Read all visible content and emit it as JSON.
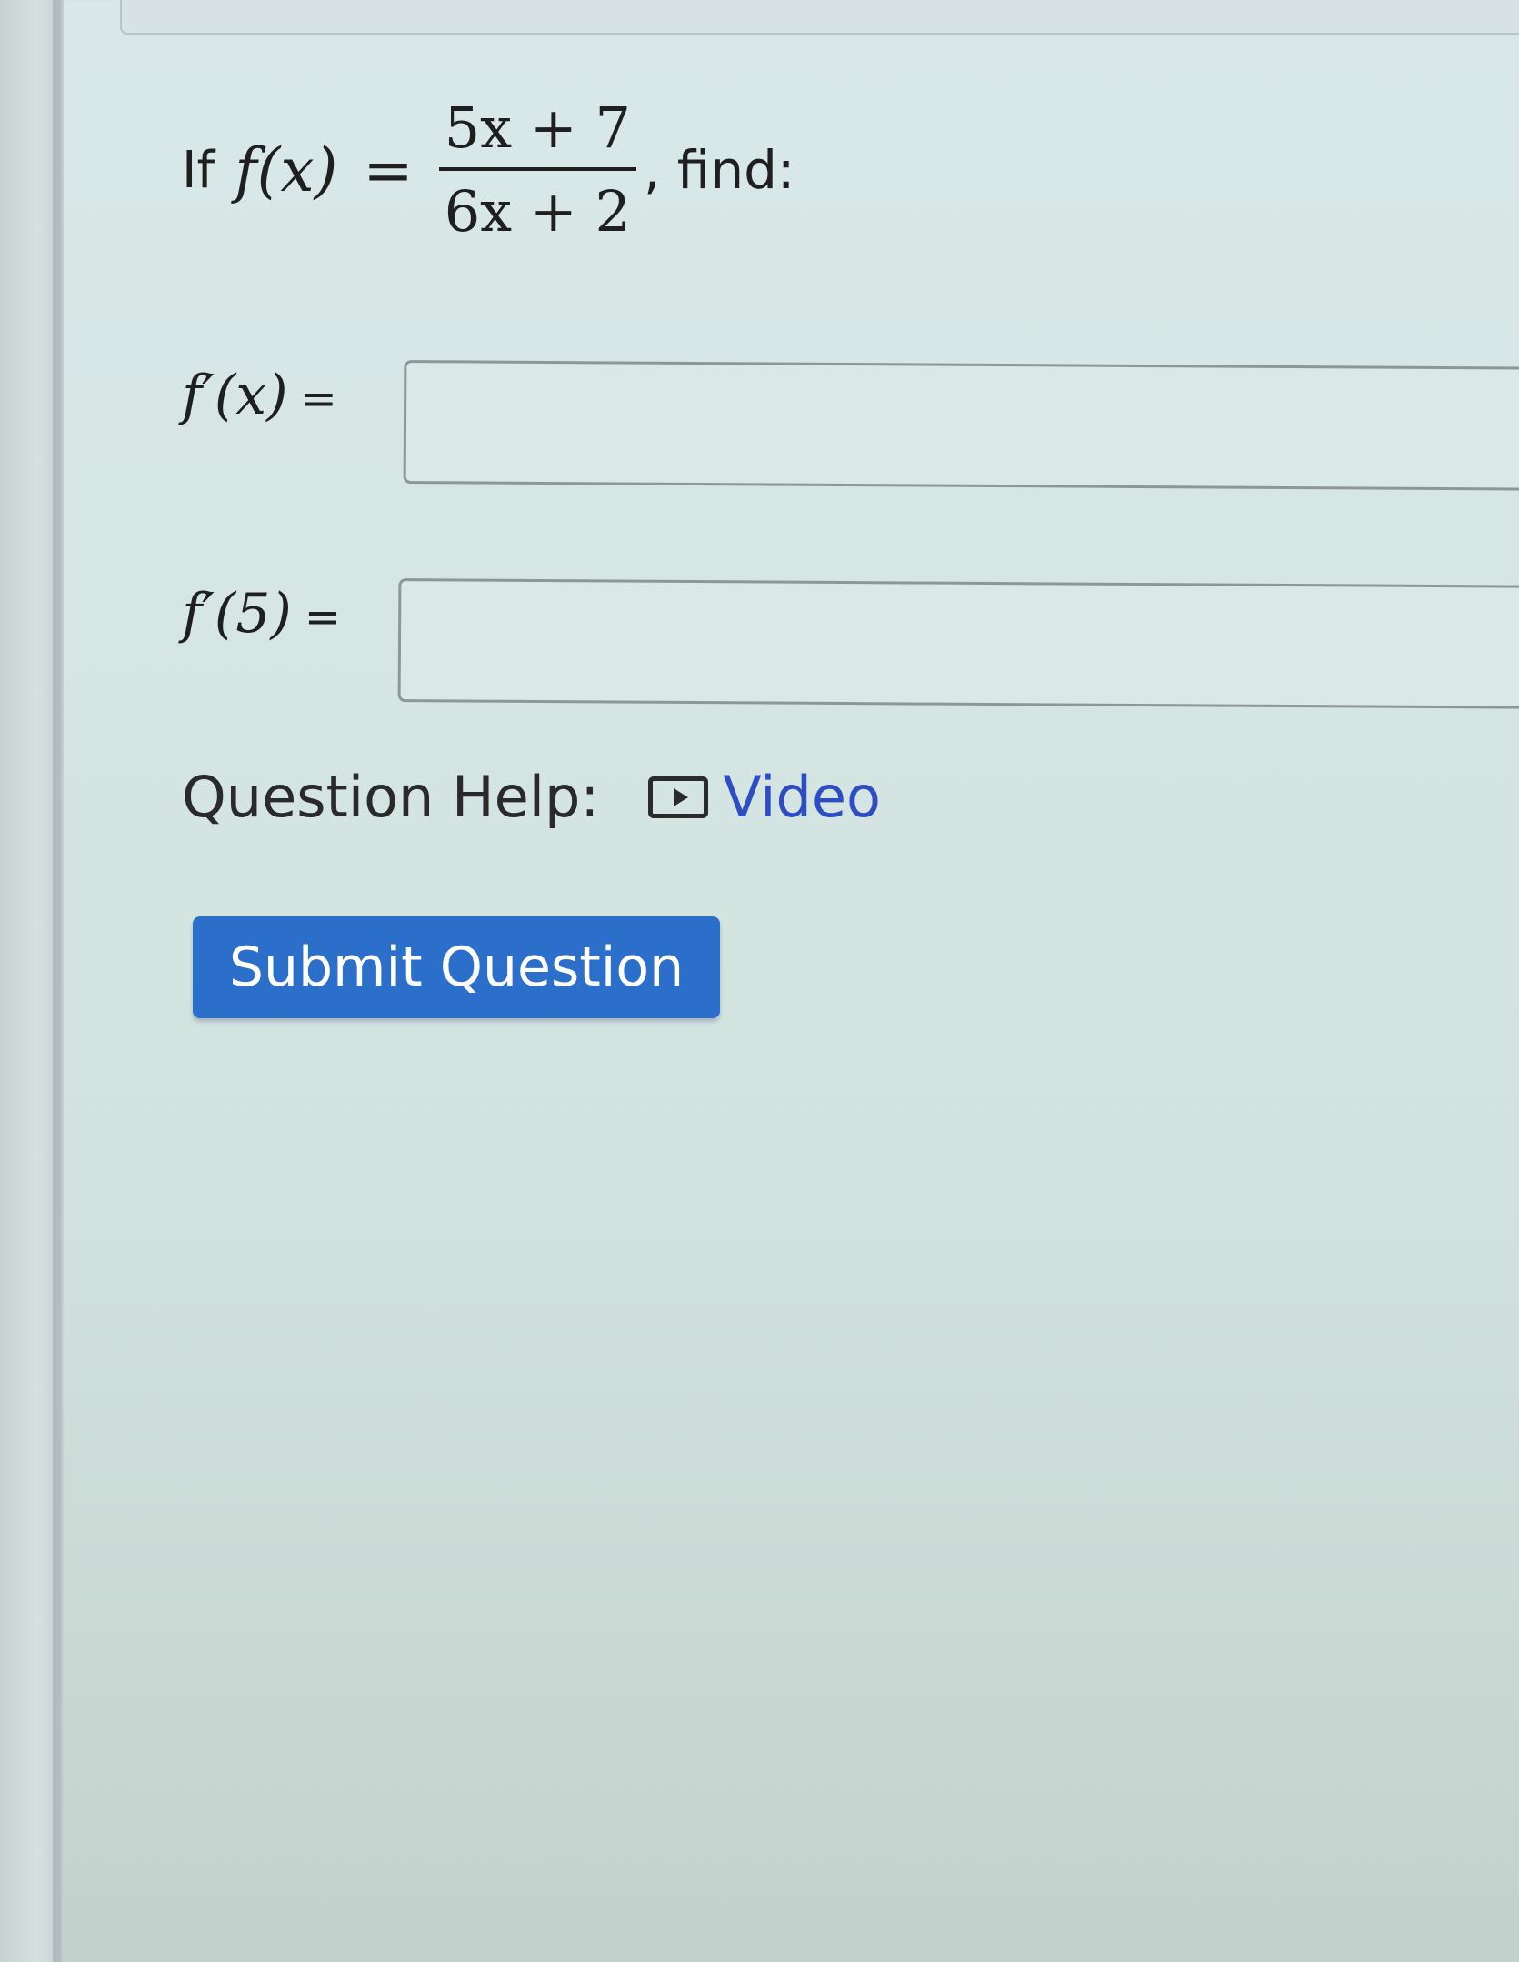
{
  "question": {
    "prefix": "If",
    "function_name": "f(x)",
    "equals": "=",
    "numerator": "5x + 7",
    "denominator": "6x + 2",
    "suffix": ", find:"
  },
  "answers": [
    {
      "label_fn": "f′(x)",
      "equals": "=",
      "value": ""
    },
    {
      "label_fn": "f′(5)",
      "equals": "=",
      "value": ""
    }
  ],
  "help": {
    "label": "Question Help:",
    "video_label": "Video",
    "video_icon": "play-video-icon"
  },
  "submit_label": "Submit Question",
  "colors": {
    "button_bg": "#2b6fcb",
    "link": "#2f4dc2",
    "background": "#d6e6e4"
  }
}
